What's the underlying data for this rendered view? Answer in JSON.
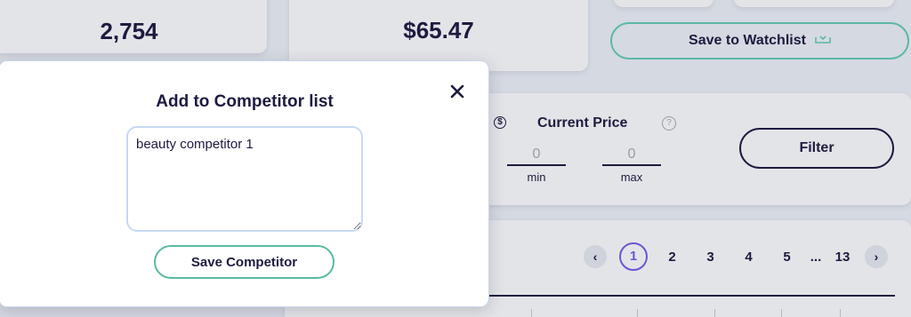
{
  "background": {
    "stats": [
      {
        "value": "2,754"
      },
      {
        "value": "$65.47"
      }
    ],
    "watchlist_button": {
      "label": "Save to Watchlist",
      "icon": "inbox-download-icon"
    },
    "filter": {
      "price_icon": "dollar-circle-icon",
      "price_label": "Current Price",
      "help_icon": "question-circle-icon",
      "min": {
        "value": "0",
        "caption": "min"
      },
      "max": {
        "value": "0",
        "caption": "max"
      },
      "filter_button": "Filter"
    },
    "pagination": {
      "prev_icon": "chevron-left-icon",
      "next_icon": "chevron-right-icon",
      "pages": [
        "1",
        "2",
        "3",
        "4",
        "5"
      ],
      "ellipsis": "...",
      "last_page": "13",
      "current_page": "1"
    }
  },
  "modal": {
    "title": "Add to Competitor list",
    "close_icon": "close-icon",
    "textarea_value": "beauty competitor 1",
    "save_button": "Save Competitor"
  },
  "colors": {
    "accent_teal": "#5ab9a4",
    "accent_purple": "#6b55d4",
    "text_dark": "#1d1b3f",
    "backdrop": "#d5d9e1"
  }
}
